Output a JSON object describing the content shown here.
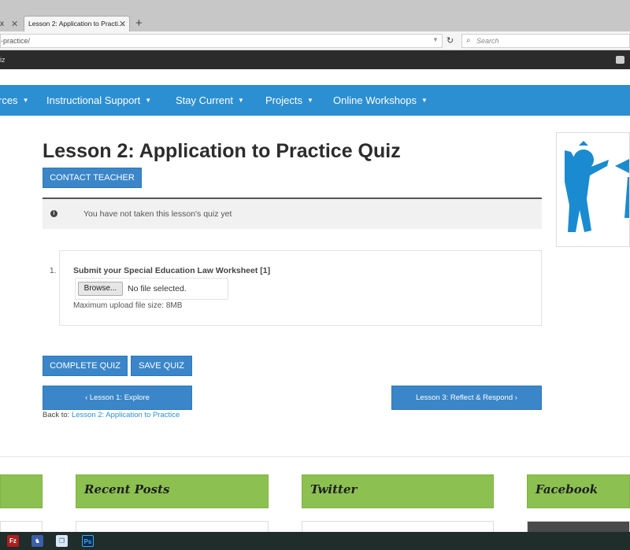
{
  "browser": {
    "prev_tab_text": "x",
    "active_tab_title": "Lesson 2: Application to Practi...",
    "url": "-practice/",
    "search_placeholder": "Search"
  },
  "bookmarks_bar": {
    "text": "iz"
  },
  "site_nav": {
    "items": [
      {
        "label": "rces"
      },
      {
        "label": "Instructional Support"
      },
      {
        "label": "Stay Current"
      },
      {
        "label": "Projects"
      },
      {
        "label": "Online Workshops"
      }
    ]
  },
  "page": {
    "title": "Lesson 2: Application to Practice Quiz",
    "contact_button": "CONTACT TEACHER",
    "notice": "You have not taken this lesson's quiz yet",
    "question": {
      "number": "1.",
      "text": "Submit your Special Education Law Worksheet [1]",
      "browse_label": "Browse...",
      "no_file": "No file selected.",
      "max_size": "Maximum upload file size: 8MB"
    },
    "complete_button": "COMPLETE QUIZ",
    "save_button": "SAVE QUIZ",
    "prev_lesson": "‹  Lesson 1: Explore",
    "next_lesson": "Lesson 3: Reflect & Respond ›",
    "back_to_label": "Back to:",
    "back_to_link": "Lesson 2: Application to Practice"
  },
  "footer": {
    "recent_posts": "Recent Posts",
    "twitter": "Twitter",
    "facebook": "Facebook"
  },
  "colors": {
    "nav_blue": "#2c8fd1",
    "button_blue": "#3a86c8",
    "footer_green": "#8cc152"
  }
}
